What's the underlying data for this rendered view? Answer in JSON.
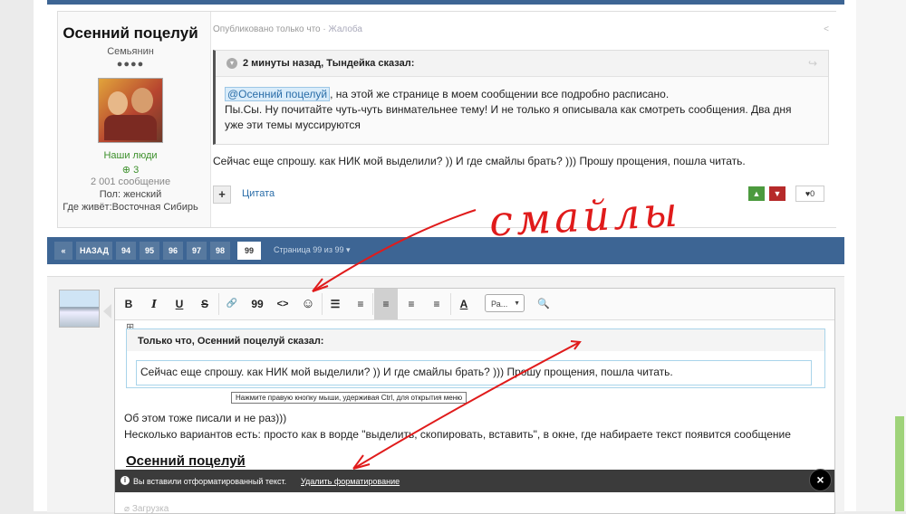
{
  "post": {
    "author_name": "Осенний поцелуй",
    "author_title": "Семьянин",
    "author_dots": "●●●●",
    "group": "Наши люди",
    "reputation": "3",
    "post_count": "2 001 сообщение",
    "gender": "Пол: женский",
    "location": "Где живёт:Восточная Сибирь",
    "meta_published": "Опубликовано только что",
    "meta_sep": " · ",
    "meta_report": "Жалоба",
    "quote_author": "2 минуты назад, Тындейка сказал:",
    "quote_mention": "@Осенний поцелуй",
    "quote_line1": ", на этой же странице в моем сообщении все подробно расписано.",
    "quote_line2": "Пы.Сы. Ну почитайте чуть-чуть винмательнее тему! И не только я описывала как смотреть сообщения. Два дня уже эти темы муссируются",
    "post_text": "Сейчас еще спрошу. как НИК мой выделили? )) И где смайлы брать? ))) Прошу прощения, пошла читать.",
    "add_label": "+",
    "cite_label": "Цитата",
    "like_count": "0"
  },
  "pagination": {
    "first": "«",
    "prev": "НАЗАД",
    "pages": [
      "94",
      "95",
      "96",
      "97",
      "98",
      "99"
    ],
    "active_page": "99",
    "info": "Страница 99 из 99  ▾"
  },
  "editor": {
    "toolbar": {
      "bold": "B",
      "italic": "I",
      "underline": "U",
      "strike": "S",
      "link": "🔗",
      "quote": "99",
      "code": "<>",
      "emoji": "☺",
      "bullets": "☰",
      "numbers": "≡",
      "align_left": "≡",
      "align_center": "≡",
      "align_right": "≡",
      "font_color": "A",
      "size_select": "Ра...",
      "preview": "🔍"
    },
    "quote_author": "Только что, Осенний поцелуй сказал:",
    "quote_text": "Сейчас еще спрошу. как НИК мой выделили? )) И где смайлы брать? ))) Прошу прощения, пошла читать.",
    "tooltip": "Нажмите правую кнопку мыши, удерживая Ctrl, для открытия меню",
    "line1": "Об этом тоже писали  и не раз)))",
    "line2": "Несколько вариантов есть: просто как в ворде \"выделить, скопировать, вставить\", в окне, где набираете текст  появится сообщение",
    "signature": "Осенний поцелуй",
    "notice_text": "Вы вставили отформатированный текст.",
    "notice_link": "Удалить форматирование",
    "notice_close": "×",
    "attach_label": "Загрузка"
  },
  "annotation": {
    "word": "смайлы",
    "color": "#e01b1b"
  }
}
